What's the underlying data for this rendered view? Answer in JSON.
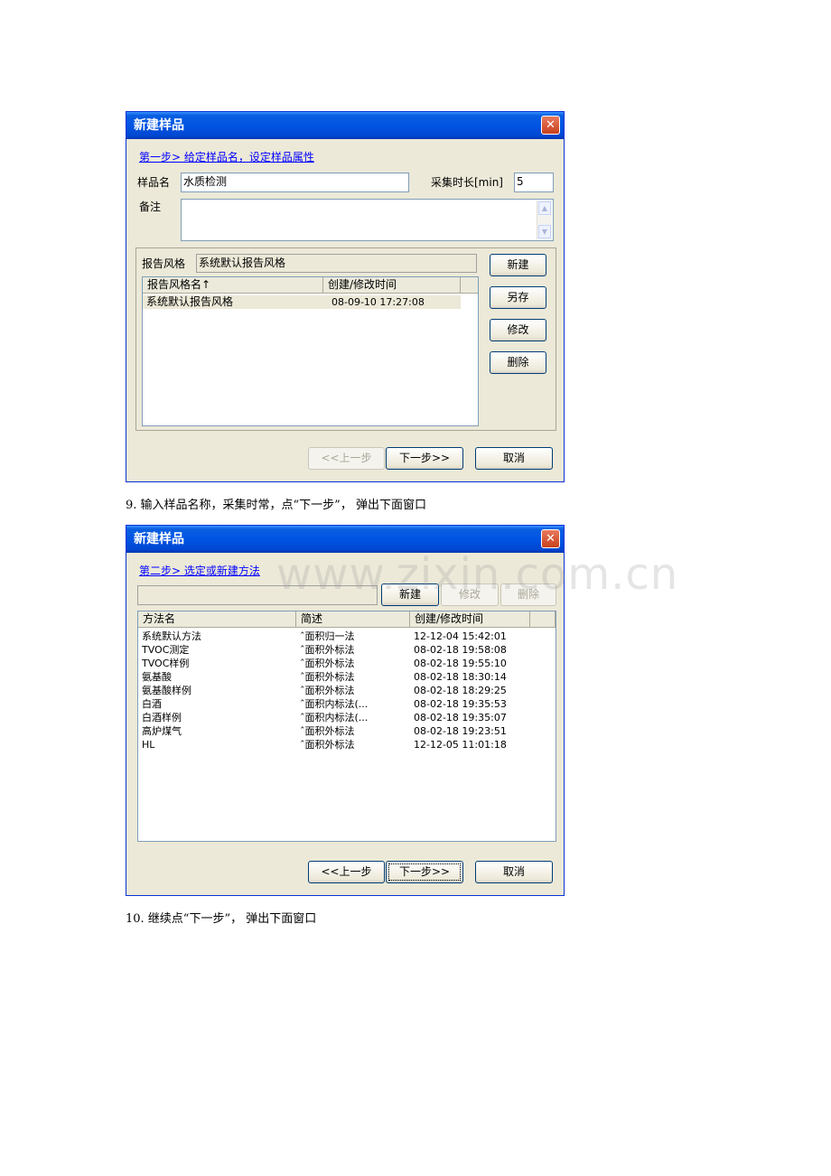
{
  "dialog1": {
    "title": "新建样品",
    "close_glyph": "✕",
    "step_link": "第一步> 给定样品名，设定样品属性",
    "sample_name_label": "样品名",
    "sample_name_value": "水质检测",
    "collect_time_label": "采集时长[min]",
    "collect_time_value": "5",
    "remark_label": "备注",
    "remark_value": "",
    "report_style_label": "报告风格",
    "report_style_value": "系统默认报告风格",
    "list_headers": [
      "报告风格名↑",
      "创建/修改时间"
    ],
    "list_rows": [
      {
        "name": "系统默认报告风格",
        "time": "08-09-10 17:27:08"
      }
    ],
    "side_buttons": {
      "new": "新建",
      "save_as": "另存",
      "modify": "修改",
      "delete": "删除"
    },
    "nav_buttons": {
      "prev": "<<上一步",
      "next": "下一步>>",
      "cancel": "取消"
    }
  },
  "caption1": "9.   输入样品名称，采集时常，点“下一步”，  弹出下面窗口",
  "dialog2": {
    "title": "新建样品",
    "close_glyph": "✕",
    "step_link": "第二步> 选定或新建方法",
    "filter_value": "",
    "top_buttons": {
      "new": "新建",
      "modify": "修改",
      "delete": "删除"
    },
    "list_headers": [
      "方法名",
      "简述",
      "创建/修改时间"
    ],
    "list_rows": [
      {
        "name": "系统默认方法",
        "desc": "ˆ面积归一法",
        "time": "12-12-04 15:42:01"
      },
      {
        "name": "TVOC测定",
        "desc": "ˆ面积外标法",
        "time": "08-02-18 19:58:08"
      },
      {
        "name": "TVOC样例",
        "desc": "ˆ面积外标法",
        "time": "08-02-18 19:55:10"
      },
      {
        "name": "氨基酸",
        "desc": "ˆ面积外标法",
        "time": "08-02-18 18:30:14"
      },
      {
        "name": "氨基酸样例",
        "desc": "ˆ面积外标法",
        "time": "08-02-18 18:29:25"
      },
      {
        "name": "白酒",
        "desc": "ˆ面积内标法(...",
        "time": "08-02-18 19:35:53"
      },
      {
        "name": "白酒样例",
        "desc": "ˆ面积内标法(...",
        "time": "08-02-18 19:35:07"
      },
      {
        "name": "高炉煤气",
        "desc": "ˆ面积外标法",
        "time": "08-02-18 19:23:51"
      },
      {
        "name": "HL",
        "desc": "ˆ面积外标法",
        "time": "12-12-05 11:01:18"
      }
    ],
    "nav_buttons": {
      "prev": "<<上一步",
      "next": "下一步>>",
      "cancel": "取消"
    }
  },
  "caption2": "10. 继续点“下一步”，  弹出下面窗口",
  "watermark": "www.zixin.com.cn"
}
